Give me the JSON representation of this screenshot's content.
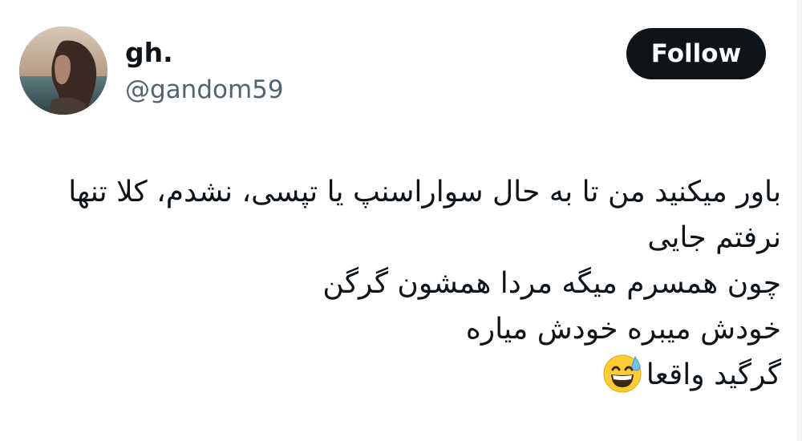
{
  "user": {
    "display_name": "gh.",
    "handle": "@gandom59"
  },
  "actions": {
    "follow_label": "Follow"
  },
  "tweet": {
    "lines": [
      "باور میکنید من تا به حال سواراسنپ یا تپسی، نشدم، کلا تنها",
      "نرفتم جایی",
      "چون همسرم میگه مردا همشون گرگن",
      "خودش میبره خودش میاره",
      "گرگید واقعا"
    ],
    "emoji": "grinning-face-with-sweat"
  },
  "colors": {
    "text": "#0f1419",
    "secondary_text": "#536471",
    "follow_button_bg": "#0f1419",
    "follow_button_text": "#ffffff",
    "background": "#ffffff"
  }
}
